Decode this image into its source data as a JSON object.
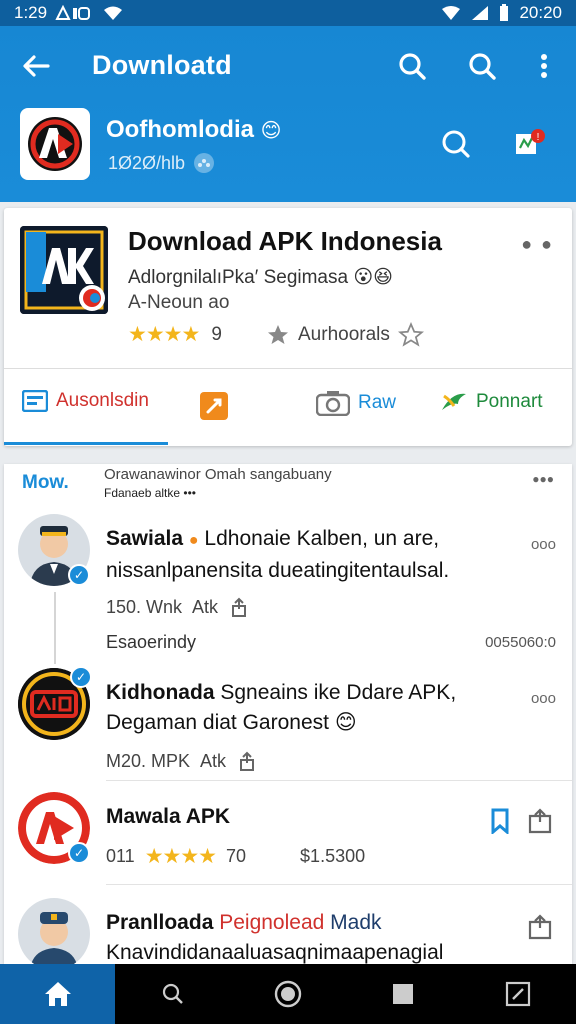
{
  "status": {
    "time_left": "1:29",
    "time_right": "20:20"
  },
  "appbar": {
    "title": "Downloatd"
  },
  "channel": {
    "name": "Oofhomlodia",
    "sub": "1Ø2Ø/hlb",
    "emoji": "😊"
  },
  "card": {
    "title": "Download APK Indonesia",
    "subtitle": "AdlorgnilalıPka′ Segimasa",
    "subtitle_emoji": "😮😆",
    "line2": "A-Neoun ao",
    "rating_stars": "★★★★",
    "rating_value": "9",
    "authors_label": "Aurhoorals",
    "tabs": [
      {
        "label": "Ausonlsdin",
        "color": "#d0312d"
      },
      {
        "label": ""
      },
      {
        "label": "Raw",
        "color": "#1a8cd8"
      },
      {
        "label": "Ponnart",
        "color": "#1e8a3c"
      }
    ]
  },
  "feed": {
    "header_label": "Mow.",
    "header_text": "Orawanawinor Omah sangabuany",
    "header_sub": "Fdanaeb altke •••",
    "posts": [
      {
        "name": "Sawiala",
        "line1": "Ldhonaie Kalben, un are,",
        "line2": "nissanlpanensita dueatingitentaulsal.",
        "meta_count": "150. Wnk",
        "meta_act": "Atk",
        "more": "ooo",
        "footer_left": "Esaoerindy",
        "footer_right": "0055060:0"
      },
      {
        "name": "Kidhonada",
        "line1": "Sgneains ike Ddare APK,",
        "line2": "Degaman diat Garonest",
        "emoji": "😊",
        "meta_count": "M20. MPK",
        "meta_act": "Atk",
        "more": "ooo"
      },
      {
        "name": "Mawala APK",
        "meta_count": "011",
        "rating_stars": "★★★★",
        "meta_rating": "70",
        "meta_price": "$1.5300"
      },
      {
        "name": "Pranlloada",
        "name2": "Peignolead",
        "name3": "Madk",
        "line2": "Knavindidanaaluasaqnimaapenagial"
      }
    ]
  }
}
